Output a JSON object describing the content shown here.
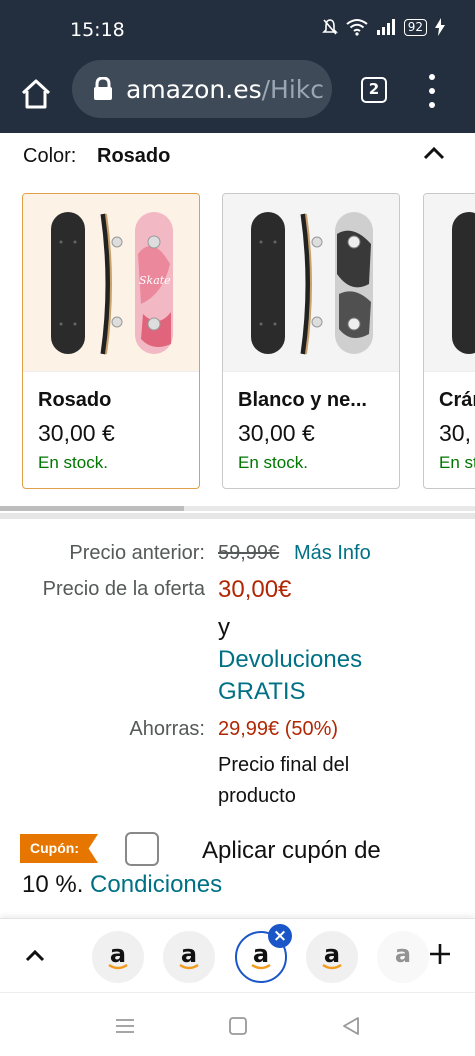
{
  "status": {
    "time": "15:18",
    "battery": "92"
  },
  "browser": {
    "url_host": "amazon.es",
    "url_rest": "/Hikc",
    "tab_count": "2"
  },
  "color": {
    "label": "Color:",
    "value": "Rosado"
  },
  "swatches": [
    {
      "name": "Rosado",
      "price": "30,00 €",
      "stock": "En stock."
    },
    {
      "name": "Blanco y ne...",
      "price": "30,00 €",
      "stock": "En stock."
    },
    {
      "name": "Crán",
      "price": "30,",
      "stock": "En st"
    }
  ],
  "price": {
    "previous_label": "Precio anterior:",
    "previous_value": "59,99€",
    "more_info": "Más Info",
    "offer_label": "Precio de la oferta",
    "offer_value": "30,00€",
    "and": "y",
    "returns_line1": "Devoluciones",
    "returns_line2": "GRATIS",
    "savings_label": "Ahorras:",
    "savings_value": "29,99€ (50%)",
    "final_line1": "Precio final del",
    "final_line2": "producto"
  },
  "coupon": {
    "badge": "Cupón:",
    "text_line1": "Aplicar cupón de",
    "text_line2_prefix": "10 %.",
    "conditions": "Condiciones"
  },
  "tab_strip": {
    "tab_letter": "a",
    "close": "×"
  },
  "colors": {
    "header_bg": "#232f3e",
    "link": "#007185",
    "price_red": "#b12704",
    "stock_green": "#007600",
    "coupon_orange": "#e77600",
    "active_tab": "#1a56c7"
  }
}
